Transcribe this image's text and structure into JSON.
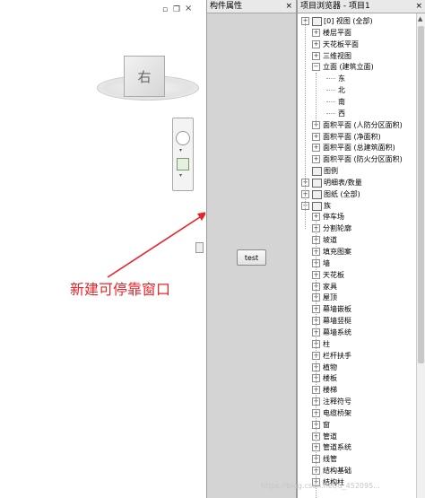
{
  "colors": {
    "annotation": "#e8232a",
    "panel_bg": "#d4d4d4"
  },
  "view": {
    "cube_face": "右",
    "annotation": "新建可停靠窗口"
  },
  "props": {
    "title": "构件属性",
    "button_label": "test"
  },
  "browser": {
    "title": "项目浏览器 - 项目1"
  },
  "tree": [
    {
      "label": "[0] 视图 (全部)",
      "level": 0,
      "icon": "view-icon"
    },
    {
      "label": "楼层平面",
      "level": 1
    },
    {
      "label": "天花板平面",
      "level": 1
    },
    {
      "label": "三维视图",
      "level": 1
    },
    {
      "label": "立面 (建筑立面)",
      "level": 1,
      "expanded": true
    },
    {
      "label": "东",
      "level": 2
    },
    {
      "label": "北",
      "level": 2
    },
    {
      "label": "南",
      "level": 2
    },
    {
      "label": "西",
      "level": 2
    },
    {
      "label": "面积平面 (人防分区面积)",
      "level": 1
    },
    {
      "label": "面积平面 (净面积)",
      "level": 1
    },
    {
      "label": "面积平面 (总建筑面积)",
      "level": 1
    },
    {
      "label": "面积平面 (防火分区面积)",
      "level": 1
    },
    {
      "label": "图例",
      "level": 0,
      "icon": "legend-icon",
      "noexp": true
    },
    {
      "label": "明细表/数量",
      "level": 0,
      "icon": "schedule-icon"
    },
    {
      "label": "图纸 (全部)",
      "level": 0,
      "icon": "sheet-icon"
    },
    {
      "label": "族",
      "level": 0,
      "icon": "family-icon",
      "expanded": true
    },
    {
      "label": "停车场",
      "level": 1
    },
    {
      "label": "分割轮廓",
      "level": 1
    },
    {
      "label": "坡道",
      "level": 1
    },
    {
      "label": "填充图案",
      "level": 1
    },
    {
      "label": "墙",
      "level": 1
    },
    {
      "label": "天花板",
      "level": 1
    },
    {
      "label": "家具",
      "level": 1
    },
    {
      "label": "屋顶",
      "level": 1
    },
    {
      "label": "幕墙嵌板",
      "level": 1
    },
    {
      "label": "幕墙竖梃",
      "level": 1
    },
    {
      "label": "幕墙系统",
      "level": 1
    },
    {
      "label": "柱",
      "level": 1
    },
    {
      "label": "栏杆扶手",
      "level": 1
    },
    {
      "label": "植物",
      "level": 1
    },
    {
      "label": "楼板",
      "level": 1
    },
    {
      "label": "楼梯",
      "level": 1
    },
    {
      "label": "注释符号",
      "level": 1
    },
    {
      "label": "电缆桥架",
      "level": 1
    },
    {
      "label": "窗",
      "level": 1
    },
    {
      "label": "管道",
      "level": 1
    },
    {
      "label": "管道系统",
      "level": 1
    },
    {
      "label": "线管",
      "level": 1
    },
    {
      "label": "结构基础",
      "level": 1
    },
    {
      "label": "结构柱",
      "level": 1
    }
  ],
  "watermark": "https://blog.csdn.net/u_452095..."
}
